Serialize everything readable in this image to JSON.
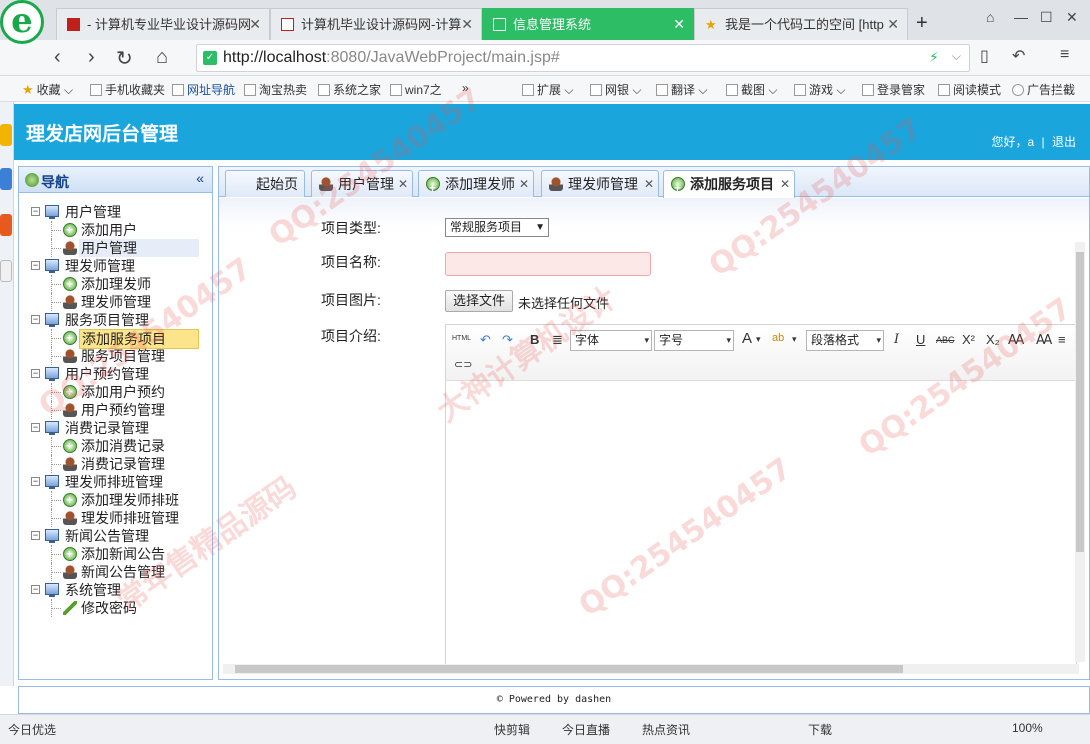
{
  "browser": {
    "tabs": [
      {
        "title": "- 计算机专业毕业设计源码网",
        "active": false
      },
      {
        "title": "计算机毕业设计源码网-计算",
        "active": false
      },
      {
        "title": "信息管理系统",
        "active": true
      },
      {
        "title": "我是一个代码工的空间 [http",
        "active": false
      }
    ],
    "url_host": "http://localhost",
    "url_path": ":8080/JavaWebProject/main.jsp#",
    "bookmarks": [
      "收藏",
      "手机收藏夹",
      "网址导航",
      "淘宝热卖",
      "系统之家",
      "win7之",
      "»",
      "扩展",
      "网银",
      "翻译",
      "截图",
      "游戏",
      "登录管家",
      "阅读模式",
      "广告拦截"
    ]
  },
  "app": {
    "title": "理发店网后台管理",
    "greeting": "您好，a",
    "separator": "|",
    "logout": "退出"
  },
  "nav": {
    "title": "导航",
    "collapse": "«",
    "groups": [
      {
        "label": "用户管理",
        "items": [
          {
            "label": "添加用户",
            "icon": "add"
          },
          {
            "label": "用户管理",
            "icon": "user"
          }
        ]
      },
      {
        "label": "理发师管理",
        "items": [
          {
            "label": "添加理发师",
            "icon": "add"
          },
          {
            "label": "理发师管理",
            "icon": "user"
          }
        ]
      },
      {
        "label": "服务项目管理",
        "items": [
          {
            "label": "添加服务项目",
            "icon": "add"
          },
          {
            "label": "服务项目管理",
            "icon": "user"
          }
        ]
      },
      {
        "label": "用户预约管理",
        "items": [
          {
            "label": "添加用户预约",
            "icon": "add"
          },
          {
            "label": "用户预约管理",
            "icon": "user"
          }
        ]
      },
      {
        "label": "消费记录管理",
        "items": [
          {
            "label": "添加消费记录",
            "icon": "add"
          },
          {
            "label": "消费记录管理",
            "icon": "user"
          }
        ]
      },
      {
        "label": "理发师排班管理",
        "items": [
          {
            "label": "添加理发师排班",
            "icon": "add"
          },
          {
            "label": "理发师排班管理",
            "icon": "user"
          }
        ]
      },
      {
        "label": "新闻公告管理",
        "items": [
          {
            "label": "添加新闻公告",
            "icon": "add"
          },
          {
            "label": "新闻公告管理",
            "icon": "user"
          }
        ]
      },
      {
        "label": "系统管理",
        "items": [
          {
            "label": "修改密码",
            "icon": "pen"
          }
        ]
      }
    ]
  },
  "page_tabs": [
    {
      "label": "起始页",
      "closable": false
    },
    {
      "label": "用户管理",
      "closable": true
    },
    {
      "label": "添加理发师",
      "closable": true
    },
    {
      "label": "理发师管理",
      "closable": true
    },
    {
      "label": "添加服务项目",
      "closable": true,
      "active": true
    }
  ],
  "form": {
    "type_label": "项目类型:",
    "type_value": "常规服务项目",
    "name_label": "项目名称:",
    "name_value": "",
    "image_label": "项目图片:",
    "file_button": "选择文件",
    "file_none": "未选择任何文件",
    "intro_label": "项目介绍:"
  },
  "editor_toolbar": {
    "html": "HTML",
    "bold": "B",
    "font_family": "字体",
    "font_size": "字号",
    "font_color": "A",
    "paragraph": "段落格式",
    "italic": "I",
    "underline": "U",
    "strike": "ABC",
    "superscript": "X²",
    "subscript": "X₂"
  },
  "footer": "© Powered by dashen",
  "statusbar": {
    "left": "今日优选",
    "items": [
      "快剪辑",
      "今日直播",
      "热点资讯",
      "下载",
      "100%"
    ]
  },
  "watermarks": [
    "QQ:254540457",
    "大神计算机设计",
    "常年售精品源码"
  ]
}
